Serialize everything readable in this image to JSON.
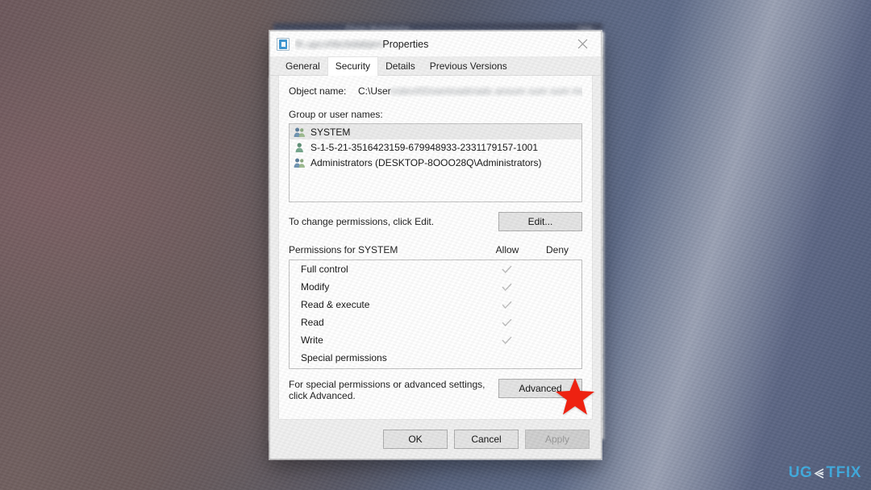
{
  "window": {
    "title_filename": "th.upcxhbcbdabjen",
    "title_suffix": "Properties",
    "file_icon": "media-file-icon",
    "close_icon": "close-icon"
  },
  "background": {
    "blurred_titlebar_text": "Photo Multimedia",
    "blurred_titlebar_text_right": "Help"
  },
  "tabs": [
    {
      "label": "General",
      "active": false
    },
    {
      "label": "Security",
      "active": true
    },
    {
      "label": "Details",
      "active": false
    },
    {
      "label": "Previous Versions",
      "active": false
    }
  ],
  "object_name": {
    "label": "Object name:",
    "value_clear": "C:\\User",
    "value_redacted": "s\\devil\\Downloads\\ads ansum sum sum mun mp mp"
  },
  "group_list": {
    "label": "Group or user names:",
    "items": [
      {
        "name": "SYSTEM",
        "icon": "group-users-icon",
        "selected": true
      },
      {
        "name": "S-1-5-21-3516423159-679948933-2331179157-1001",
        "icon": "single-user-icon",
        "selected": false
      },
      {
        "name": "Administrators (DESKTOP-8OOO28Q\\Administrators)",
        "icon": "group-users-icon",
        "selected": false
      }
    ]
  },
  "edit_section": {
    "hint": "To change permissions, click Edit.",
    "button_label": "Edit..."
  },
  "permissions": {
    "title": "Permissions for SYSTEM",
    "columns": [
      "Allow",
      "Deny"
    ],
    "rows": [
      {
        "name": "Full control",
        "allow": true,
        "deny": false
      },
      {
        "name": "Modify",
        "allow": true,
        "deny": false
      },
      {
        "name": "Read & execute",
        "allow": true,
        "deny": false
      },
      {
        "name": "Read",
        "allow": true,
        "deny": false
      },
      {
        "name": "Write",
        "allow": true,
        "deny": false
      },
      {
        "name": "Special permissions",
        "allow": false,
        "deny": false
      }
    ]
  },
  "advanced_section": {
    "hint_line1": "For special permissions or advanced settings,",
    "hint_line2": "click Advanced.",
    "button_label": "Advanced"
  },
  "footer": {
    "ok_label": "OK",
    "cancel_label": "Cancel",
    "apply_label": "Apply",
    "apply_disabled": true
  },
  "annotation": {
    "star_icon": "red-star-icon",
    "star_color": "#ee2211"
  },
  "watermark": {
    "prefix": "UG",
    "arrow_icon": "double-chevron-icon",
    "suffix": "TFIX",
    "color": "#3fa9dc"
  }
}
